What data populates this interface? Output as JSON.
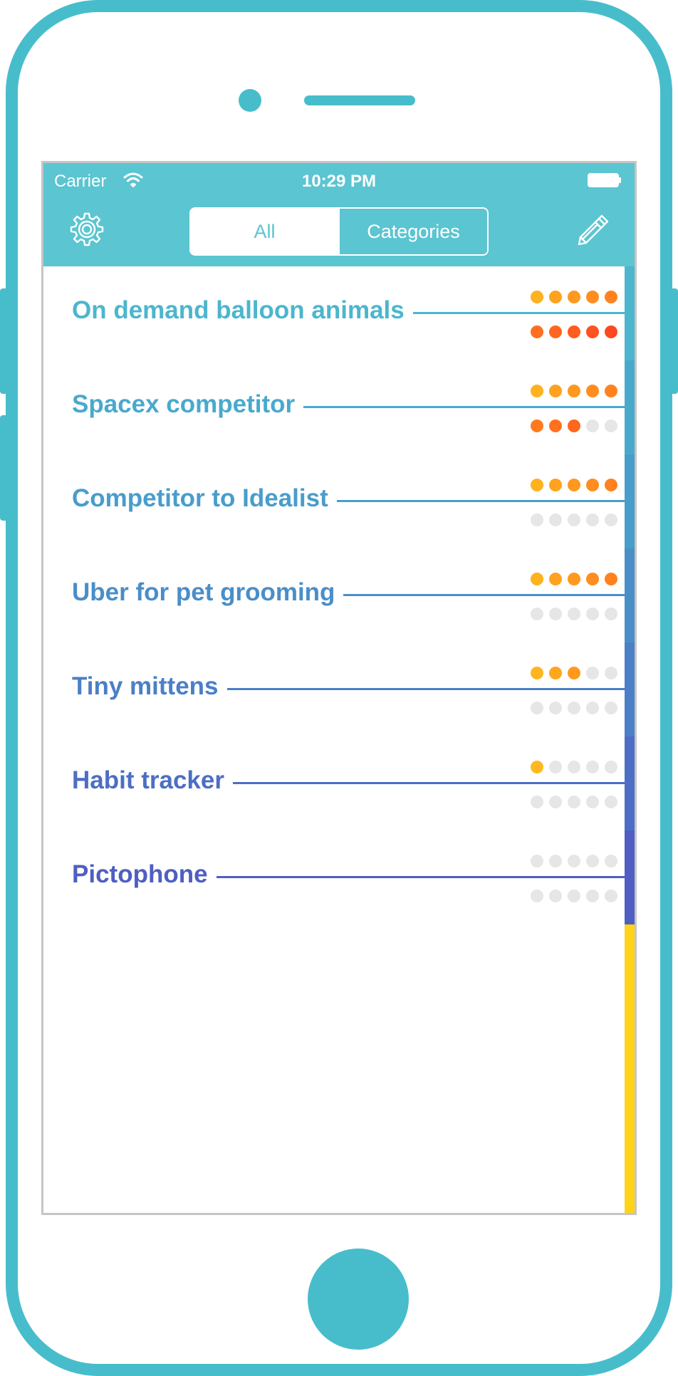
{
  "status_bar": {
    "carrier": "Carrier",
    "time": "10:29 PM",
    "wifi_icon": "wifi-icon",
    "battery_icon": "battery-icon"
  },
  "nav": {
    "settings_icon": "gear-icon",
    "edit_icon": "pencil-icon",
    "segments": [
      {
        "label": "All",
        "selected": false
      },
      {
        "label": "Categories",
        "selected": true
      }
    ]
  },
  "colors": {
    "brand": "#47bdcb",
    "navbar": "#5bc5d1",
    "dot_empty": "#e6e6e6",
    "scroll_empty": "#ffd319"
  },
  "ideas": [
    {
      "title": "On demand balloon animals",
      "color": "#4bb6cd",
      "top_dots": [
        "#ffb21f",
        "#ffa21f",
        "#ff981f",
        "#ff8d1f",
        "#ff821f"
      ],
      "bottom_dots": [
        "#ff6f1f",
        "#ff661f",
        "#ff5c1f",
        "#ff521f",
        "#ff481f"
      ]
    },
    {
      "title": "Spacex competitor",
      "color": "#49a9cd",
      "top_dots": [
        "#ffb21f",
        "#ffa21f",
        "#ff981f",
        "#ff8d1f",
        "#ff821f"
      ],
      "bottom_dots": [
        "#ff7a1f",
        "#ff701f",
        "#ff661f",
        "#e6e6e6",
        "#e6e6e6"
      ]
    },
    {
      "title": "Competitor to Idealist",
      "color": "#489dcb",
      "top_dots": [
        "#ffb21f",
        "#ffa21f",
        "#ff981f",
        "#ff8d1f",
        "#ff821f"
      ],
      "bottom_dots": [
        "#e6e6e6",
        "#e6e6e6",
        "#e6e6e6",
        "#e6e6e6",
        "#e6e6e6"
      ]
    },
    {
      "title": "Uber for pet grooming",
      "color": "#4a8ec8",
      "top_dots": [
        "#ffb21f",
        "#ffa21f",
        "#ff981f",
        "#ff8d1f",
        "#ff821f"
      ],
      "bottom_dots": [
        "#e6e6e6",
        "#e6e6e6",
        "#e6e6e6",
        "#e6e6e6",
        "#e6e6e6"
      ]
    },
    {
      "title": "Tiny mittens",
      "color": "#4b7fc6",
      "top_dots": [
        "#ffb51f",
        "#ffa61f",
        "#ff9a1f",
        "#e6e6e6",
        "#e6e6e6"
      ],
      "bottom_dots": [
        "#e6e6e6",
        "#e6e6e6",
        "#e6e6e6",
        "#e6e6e6",
        "#e6e6e6"
      ]
    },
    {
      "title": "Habit tracker",
      "color": "#4c6ec4",
      "top_dots": [
        "#ffb81f",
        "#e6e6e6",
        "#e6e6e6",
        "#e6e6e6",
        "#e6e6e6"
      ],
      "bottom_dots": [
        "#e6e6e6",
        "#e6e6e6",
        "#e6e6e6",
        "#e6e6e6",
        "#e6e6e6"
      ]
    },
    {
      "title": "Pictophone",
      "color": "#4e5ec2",
      "top_dots": [
        "#e6e6e6",
        "#e6e6e6",
        "#e6e6e6",
        "#e6e6e6",
        "#e6e6e6"
      ],
      "bottom_dots": [
        "#e6e6e6",
        "#e6e6e6",
        "#e6e6e6",
        "#e6e6e6",
        "#e6e6e6"
      ]
    }
  ]
}
